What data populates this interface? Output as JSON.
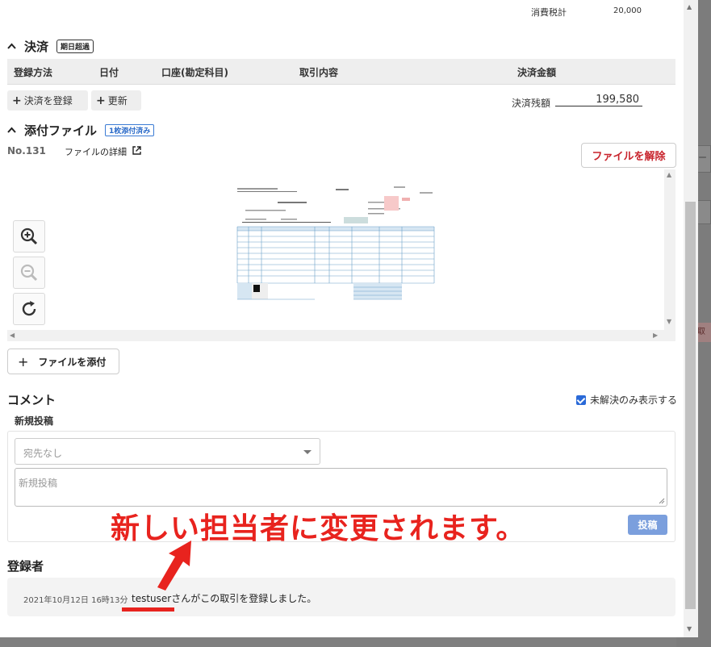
{
  "background": {
    "right_field_text": "ー",
    "right_badge_text": "取"
  },
  "tax": {
    "label": "消費税計",
    "value": "20,000"
  },
  "settlement": {
    "title": "決済",
    "badge": "期日超過",
    "columns": [
      "登録方法",
      "日付",
      "口座(勘定科目)",
      "取引内容",
      "決済金額"
    ],
    "register_button": "決済を登録",
    "update_button": "更新",
    "remaining_label": "決済残額",
    "remaining_value": "199,580"
  },
  "attachments": {
    "title": "添付ファイル",
    "badge": "1枚添付済み",
    "file_no": "No.131",
    "file_detail": "ファイルの詳細",
    "release_button": "ファイルを解除",
    "attach_button": "ファイルを添付"
  },
  "comments": {
    "title": "コメント",
    "unresolved_only": "未解決のみ表示する",
    "new_post_label": "新規投稿",
    "recipient_placeholder": "宛先なし",
    "post_placeholder": "新規投稿",
    "post_button": "投稿"
  },
  "annotation": {
    "text": "新しい担当者に変更されます。",
    "color": "#e8231e"
  },
  "registrant": {
    "title": "登録者",
    "date": "2021年10月12日 16時13分",
    "message": "testuserさんがこの取引を登録しました。"
  },
  "colors": {
    "accent_blue": "#2a6ac8",
    "danger_red": "#c8232c",
    "post_button": "#7b9fdd"
  }
}
